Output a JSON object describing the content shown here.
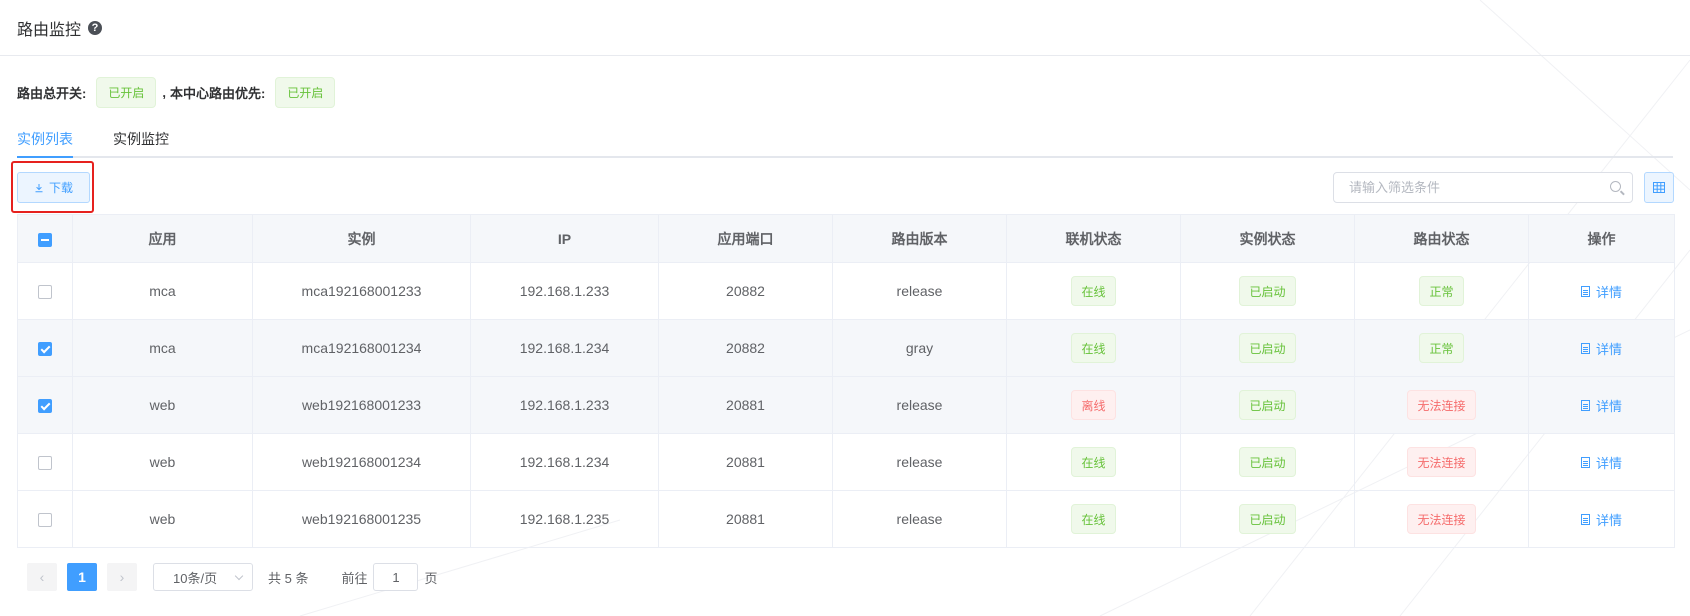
{
  "header": {
    "title": "路由监控",
    "help_icon": "question-circle-icon"
  },
  "switches": {
    "master_label": "路由总开关:",
    "master_status": "已开启",
    "separator": ",",
    "center_label": "本中心路由优先:",
    "center_status": "已开启"
  },
  "tabs": [
    {
      "label": "实例列表",
      "active": true
    },
    {
      "label": "实例监控",
      "active": false
    }
  ],
  "toolbar": {
    "download_label": "下载",
    "download_icon": "download-icon",
    "filter_placeholder": "请输入筛选条件",
    "column_toggle_icon": "table-columns-icon"
  },
  "table": {
    "headers": [
      "应用",
      "实例",
      "IP",
      "应用端口",
      "路由版本",
      "联机状态",
      "实例状态",
      "路由状态",
      "操作"
    ],
    "select_all_state": "indeterminate",
    "rows": [
      {
        "checked": false,
        "app": "mca",
        "instance": "mca192168001233",
        "ip": "192.168.1.233",
        "port": "20882",
        "version": "release",
        "online": "在线",
        "online_type": "success",
        "inst_status": "已启动",
        "inst_type": "success",
        "route_status": "正常",
        "route_type": "success",
        "action": "详情"
      },
      {
        "checked": true,
        "app": "mca",
        "instance": "mca192168001234",
        "ip": "192.168.1.234",
        "port": "20882",
        "version": "gray",
        "online": "在线",
        "online_type": "success",
        "inst_status": "已启动",
        "inst_type": "success",
        "route_status": "正常",
        "route_type": "success",
        "action": "详情"
      },
      {
        "checked": true,
        "app": "web",
        "instance": "web192168001233",
        "ip": "192.168.1.233",
        "port": "20881",
        "version": "release",
        "online": "离线",
        "online_type": "danger",
        "inst_status": "已启动",
        "inst_type": "success",
        "route_status": "无法连接",
        "route_type": "danger",
        "action": "详情"
      },
      {
        "checked": false,
        "app": "web",
        "instance": "web192168001234",
        "ip": "192.168.1.234",
        "port": "20881",
        "version": "release",
        "online": "在线",
        "online_type": "success",
        "inst_status": "已启动",
        "inst_type": "success",
        "route_status": "无法连接",
        "route_type": "danger",
        "action": "详情"
      },
      {
        "checked": false,
        "app": "web",
        "instance": "web192168001235",
        "ip": "192.168.1.235",
        "port": "20881",
        "version": "release",
        "online": "在线",
        "online_type": "success",
        "inst_status": "已启动",
        "inst_type": "success",
        "route_status": "无法连接",
        "route_type": "danger",
        "action": "详情"
      }
    ]
  },
  "pagination": {
    "prev": "‹",
    "next": "›",
    "current_page": "1",
    "page_size": "10条/页",
    "total": "共 5 条",
    "goto_prefix": "前往",
    "goto_value": "1",
    "goto_suffix": "页"
  },
  "colors": {
    "primary": "#409eff",
    "success": "#67c23a",
    "danger": "#f56c6c",
    "highlight": "#e6211e"
  }
}
